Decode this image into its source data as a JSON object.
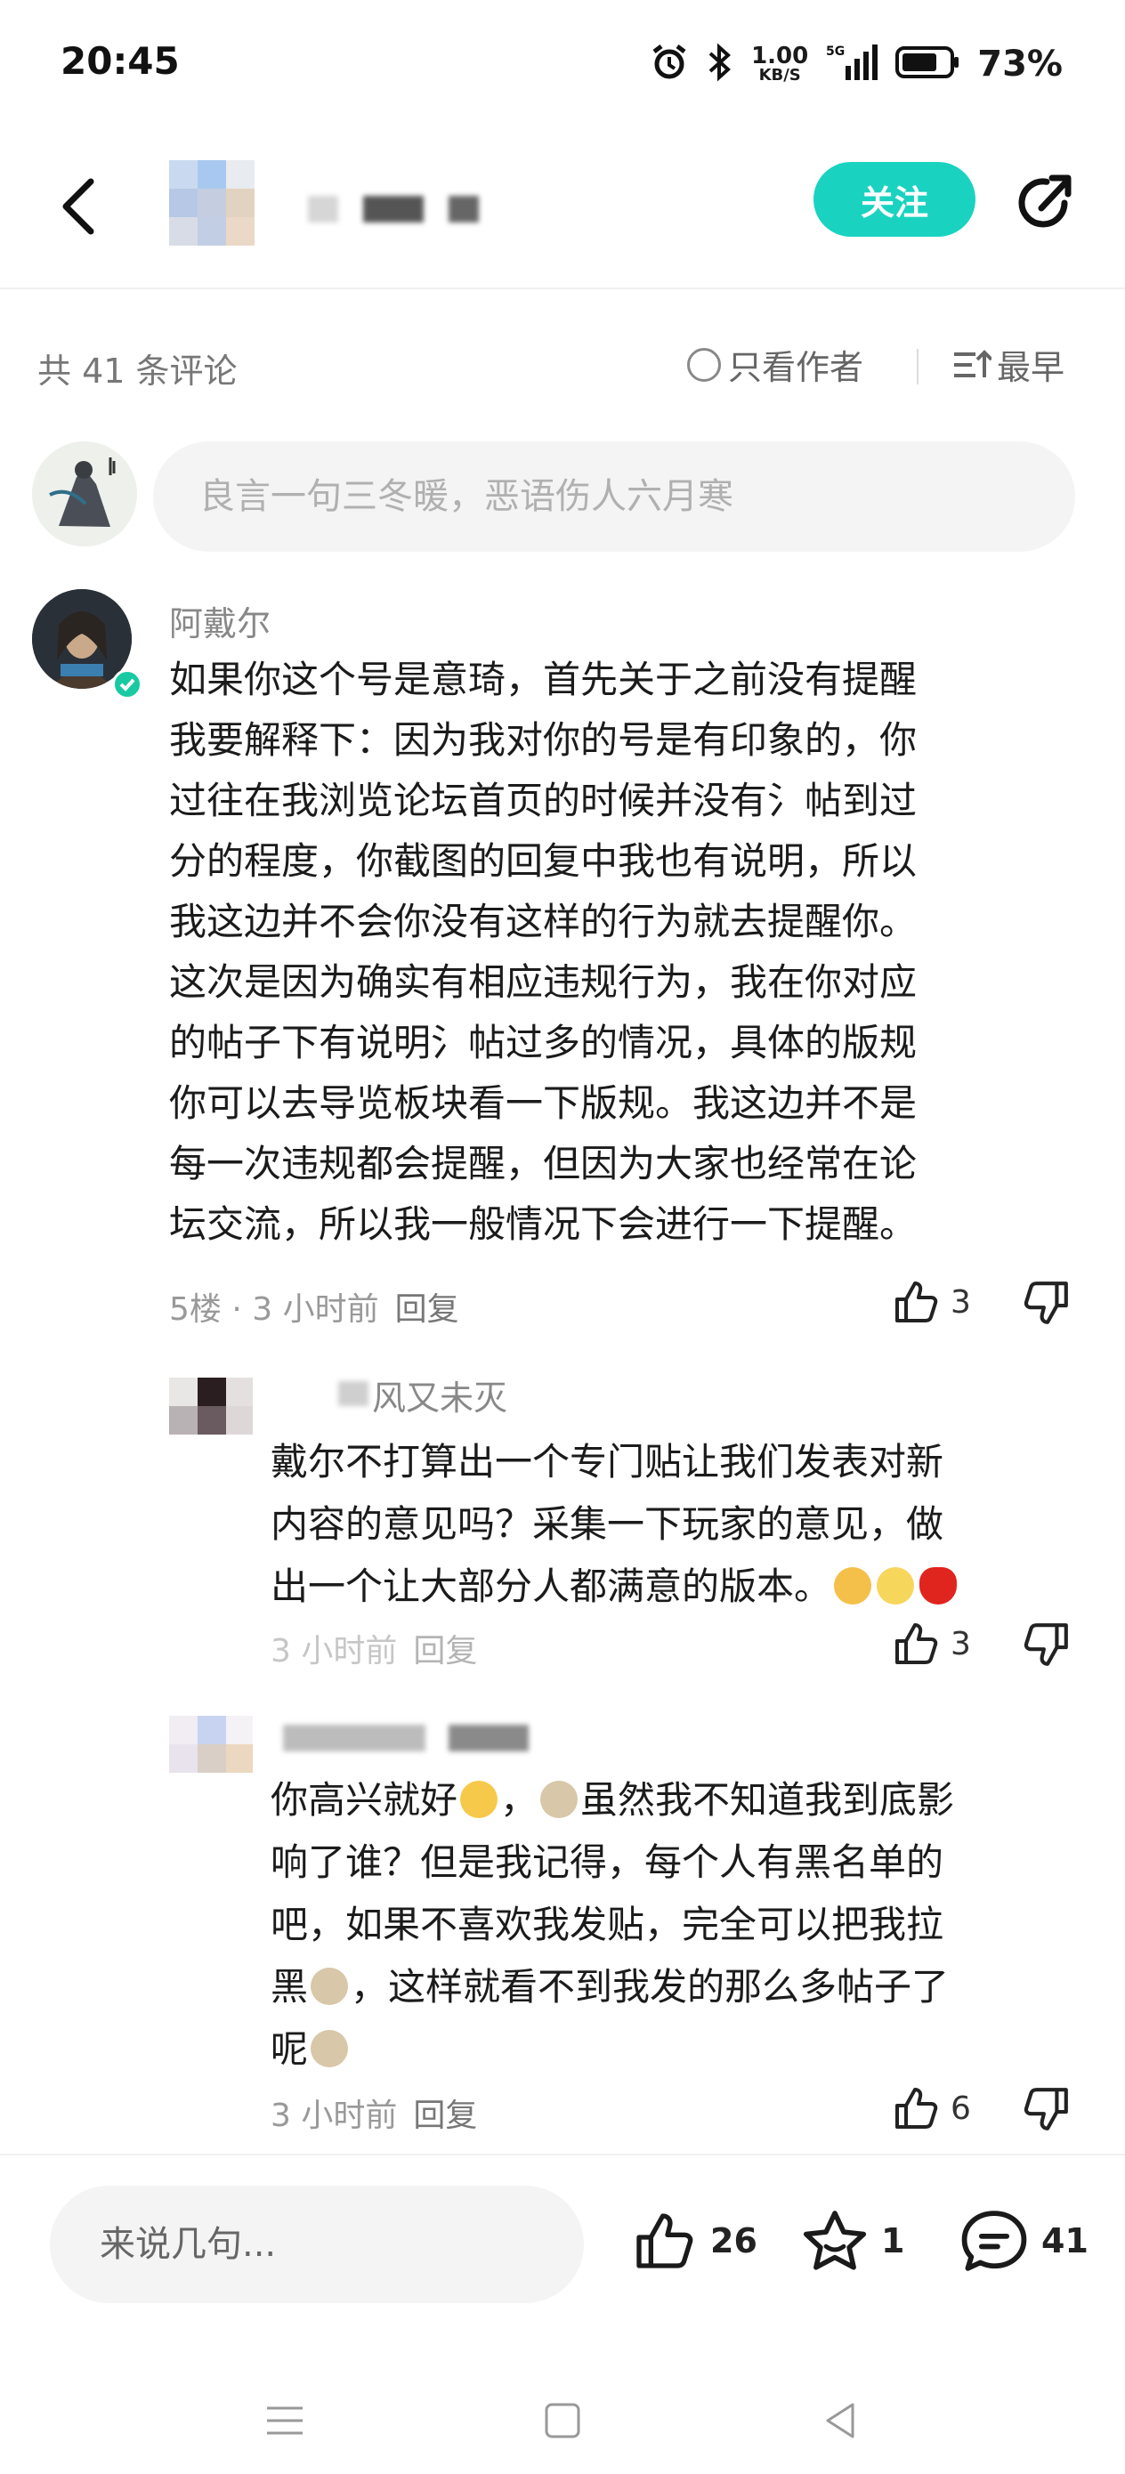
{
  "status_bar": {
    "time": "20:45",
    "net_speed_value": "1.00",
    "net_speed_unit": "KB/S",
    "network": "5G",
    "battery_percent": "73%",
    "icons": [
      "alarm-icon",
      "bluetooth-icon",
      "signal-icon",
      "battery-icon"
    ]
  },
  "header": {
    "follow_label": "关注",
    "icons": [
      "back-icon",
      "share-icon"
    ],
    "accent_color": "#19d3c0"
  },
  "comments_bar": {
    "count_label": "共 41 条评论",
    "only_author_label": "只看作者",
    "sort_label": "最早"
  },
  "comment_input": {
    "placeholder": "良言一句三冬暖，恶语伤人六月寒"
  },
  "main_comment": {
    "author": "阿戴尔",
    "text": "如果你这个号是意琦，首先关于之前没有提醒\n我要解释下：因为我对你的号是有印象的，你\n过往在我浏览论坛首页的时候并没有氵帖到过\n分的程度，你截图的回复中我也有说明，所以\n我这边并不会你没有这样的行为就去提醒你。\n这次是因为确实有相应违规行为，我在你对应\n的帖子下有说明氵帖过多的情况，具体的版规\n你可以去导览板块看一下版规。我这边并不是\n每一次违规都会提醒，但因为大家也经常在论\n坛交流，所以我一般情况下会进行一下提醒。",
    "floor_time": "5楼 · 3 小时前",
    "reply_label": "回复",
    "likes": "3"
  },
  "replies": [
    {
      "author": "风又未灭",
      "text_before_emoji": "戴尔不打算出一个专门贴让我们发表对新\n内容的意见吗？采集一下玩家的意见，做\n出一个让大部分人都满意的版本。",
      "time": "3 小时前",
      "reply_label": "回复",
      "likes": "3"
    },
    {
      "text_1": "你高兴就好",
      "text_2": "，",
      "text_3": "虽然我不知道我到底影\n响了谁？但是我记得，每个人有黑名单的\n吧，如果不喜欢我发贴，完全可以把我拉\n黑",
      "text_4": "，这样就看不到我发的那么多帖子了\n呢",
      "time": "3 小时前",
      "reply_label": "回复",
      "likes": "6"
    }
  ],
  "bottom_bar": {
    "input_placeholder": "来说几句...",
    "like_count": "26",
    "star_count": "1",
    "comment_count": "41"
  }
}
